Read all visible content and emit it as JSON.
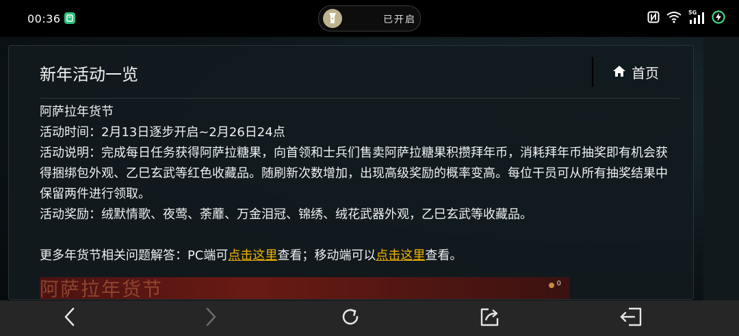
{
  "status_bar": {
    "time": "00:36",
    "app_icon_glyph": "",
    "pill_text": "已开启",
    "network_label": "5G"
  },
  "header": {
    "title": "新年活动一览",
    "home_label": "首页"
  },
  "article": {
    "line1": "阿萨拉年货节",
    "line2": "活动时间：2月13日逐步开启~2月26日24点",
    "line3": "活动说明：完成每日任务获得阿萨拉糖果，向首领和士兵们售卖阿萨拉糖果积攒拜年币，消耗拜年币抽奖即有机会获得捆绑包外观、乙巳玄武等红色收藏品。随刷新次数增加，出现高级奖励的概率变高。每位干员可从所有抽奖结果中保留两件进行领取。",
    "line4": "活动奖励：绒默情歌、夜莺、荼蘼、万金泪冠、锦绣、绒花武器外观，乙巳玄武等收藏品。",
    "faq_prefix": "更多年货节相关问题解答：PC端可",
    "faq_link1": "点击这里",
    "faq_mid": "查看；移动端可以",
    "faq_link2": "点击这里",
    "faq_suffix": "查看。"
  },
  "banner": {
    "text": "阿萨拉年货节",
    "count": "0"
  },
  "icons": {
    "home": "home-icon",
    "back": "chevron-left-icon",
    "forward": "chevron-right-icon",
    "reload": "reload-icon",
    "share": "share-icon",
    "exit": "exit-icon"
  },
  "colors": {
    "link": "#f0b400",
    "background": "#0b1014",
    "navbar": "#262626"
  }
}
